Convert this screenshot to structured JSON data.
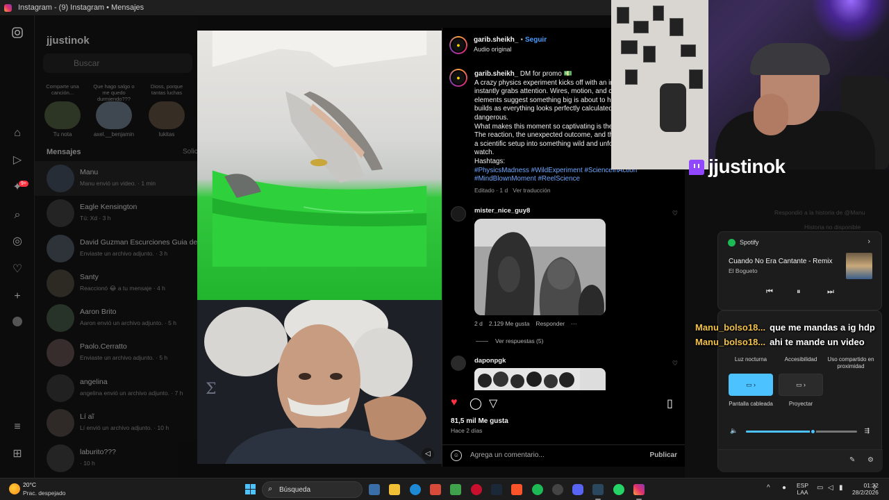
{
  "window": {
    "title": "Instagram - (9) Instagram • Mensajes"
  },
  "nav": {
    "notification_badge": "9+"
  },
  "messages_panel": {
    "username": "jjustinok",
    "search_placeholder": "Buscar",
    "notes": [
      {
        "bubble": "Comparte una canción...",
        "name": "Tu nota"
      },
      {
        "bubble": "Que hago salgo o me quedo durmiendo???",
        "name": "axel.__benjamin"
      },
      {
        "bubble": "Dioss, porque tantas luchas",
        "name": "lukitas"
      }
    ],
    "header": "Mensajes",
    "header_right": "Solicitudes",
    "conversations": [
      {
        "name": "Manu",
        "preview": "Manu envió un video. · 1 min",
        "active": true
      },
      {
        "name": "Eagle Kensington",
        "preview": "Tú: Xd · 3 h"
      },
      {
        "name": "David Guzman Escurciones Guia de Pesca",
        "preview": "Enviaste un archivo adjunto. · 3 h"
      },
      {
        "name": "Santy",
        "preview": "Reaccionó 😂 a tu mensaje · 4 h"
      },
      {
        "name": "Aaron Brito",
        "preview": "Aaron envió un archivo adjunto. · 5 h"
      },
      {
        "name": "Paolo.Cerratto",
        "preview": "Enviaste un archivo adjunto. · 5 h"
      },
      {
        "name": "angelina",
        "preview": "angelina envió un archivo adjunto. · 7 h"
      },
      {
        "name": "Lí aĩ",
        "preview": "Lí envió un archivo adjunto. · 10 h"
      },
      {
        "name": "laburito???",
        "preview": "· 10 h"
      }
    ]
  },
  "post": {
    "author": "garib.sheikh_",
    "follow": "Seguir",
    "audio": "Audio original",
    "caption_author": "garib.sheikh_",
    "caption_lines": [
      "DM for promo 💵",
      "A crazy physics experiment kicks off with an in",
      "instantly grabs attention. Wires, motion, and c",
      "elements suggest something big is about to h",
      "builds as everything looks perfectly calculated",
      "dangerous.",
      "What makes this moment so captivating is the",
      "The reaction, the unexpected outcome, and th",
      "a scientific setup into something wild and unfo",
      "watch.",
      "Hashtags:"
    ],
    "hashtags_1": "#PhysicsMadness #WildExperiment #ScienceInAction",
    "hashtags_2": "#MindBlownMoment #ReelScience",
    "edited": "Editado · 1 d",
    "see_translation": "Ver traducción",
    "comments": [
      {
        "user": "mister_nice_guy8",
        "age": "2 d",
        "likes": "2.129 Me gusta",
        "reply": "Responder",
        "more": "···",
        "replies": "Ver respuestas (5)"
      },
      {
        "user": "daponpgk"
      }
    ],
    "likes": "81,5 mil Me gusta",
    "posted_ago": "Hace 2 días",
    "comment_placeholder": "Agrega un comentario...",
    "publish": "Publicar"
  },
  "right_panel": {
    "replied_story": "Respondió a la historia de @Manu",
    "story_unavailable": "Historia no disponible"
  },
  "stream": {
    "channel": "jjustinok",
    "chat": [
      {
        "user": "Manu_bolso18...",
        "message": "que me mandas a ig hdp"
      },
      {
        "user": "Manu_bolso18...",
        "message": "ahi te mande un video"
      }
    ]
  },
  "spotify": {
    "app": "Spotify",
    "track": "Cuando No Era Cantante - Remix",
    "artist": "El Bogueto"
  },
  "quick_settings": {
    "tiles": [
      {
        "label": "Luz nocturna"
      },
      {
        "label": "Accesibilidad"
      },
      {
        "label": "Uso compartido en proximidad"
      },
      {
        "label": "Pantalla cableada",
        "on": true
      },
      {
        "label": "Proyectar"
      }
    ],
    "volume_level": 0.6
  },
  "taskbar": {
    "temperature": "20°C",
    "weather": "Prac. despejado",
    "search": "Búsqueda",
    "lang": "ESP",
    "lang2": "LAA",
    "time": "01:32",
    "date": "28/2/2026"
  },
  "colors": {
    "accent_blue": "#4cc2ff",
    "link": "#6ea8ff",
    "follow": "#4a9eff",
    "like_red": "#ff3040",
    "chat_user": "#f3c24b",
    "spotify_green": "#1db954"
  }
}
